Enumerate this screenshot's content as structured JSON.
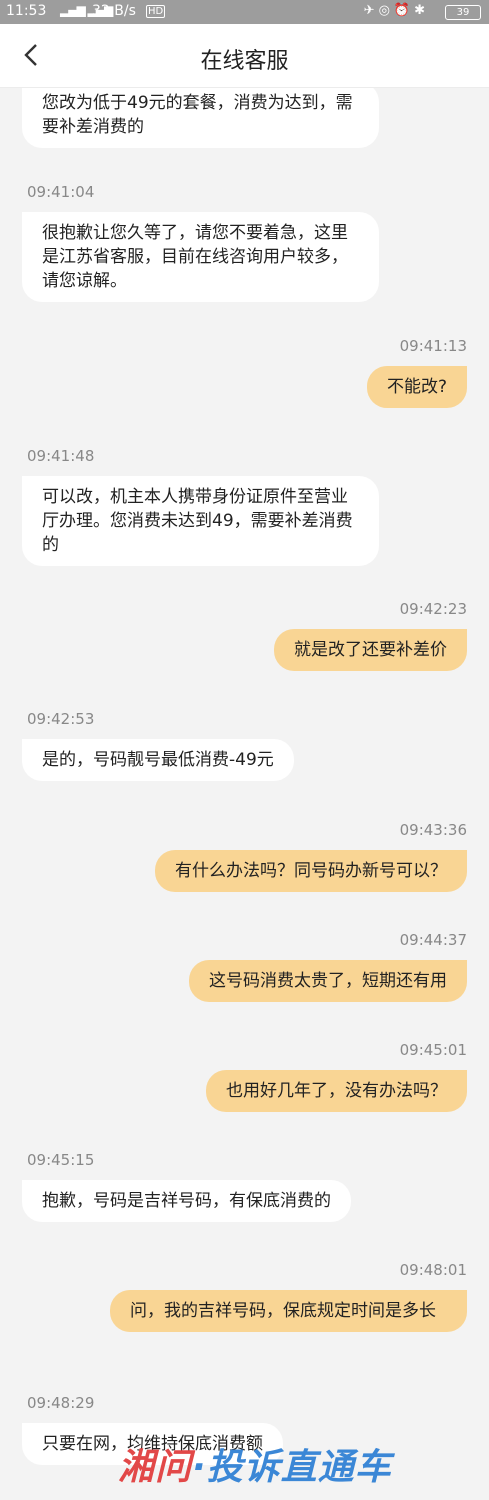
{
  "status_bar": {
    "time": "11:53",
    "net_speed": "32 B/s",
    "hd_label": "HD",
    "battery": "39"
  },
  "header": {
    "title": "在线客服"
  },
  "messages": [
    {
      "side": "in",
      "time": "",
      "text": "您改为低于49元的套餐，消费为达到，需要补差消费的"
    },
    {
      "side": "in",
      "time": "09:41:04",
      "text": "很抱歉让您久等了，请您不要着急，这里是江苏省客服，目前在线咨询用户较多，请您谅解。"
    },
    {
      "side": "out",
      "time": "09:41:13",
      "text": "不能改?"
    },
    {
      "side": "in",
      "time": "09:41:48",
      "text": "可以改，机主本人携带身份证原件至营业厅办理。您消费未达到49，需要补差消费的"
    },
    {
      "side": "out",
      "time": "09:42:23",
      "text": "就是改了还要补差价"
    },
    {
      "side": "in",
      "time": "09:42:53",
      "text": "是的，号码靓号最低消费-49元"
    },
    {
      "side": "out",
      "time": "09:43:36",
      "text": "有什么办法吗？同号码办新号可以？"
    },
    {
      "side": "out",
      "time": "09:44:37",
      "text": "这号码消费太贵了，短期还有用"
    },
    {
      "side": "out",
      "time": "09:45:01",
      "text": "也用好几年了，没有办法吗？"
    },
    {
      "side": "in",
      "time": "09:45:15",
      "text": "抱歉，号码是吉祥号码，有保底消费的"
    },
    {
      "side": "out",
      "time": "09:48:01",
      "text": "问，我的吉祥号码，保底规定时间是多长"
    },
    {
      "side": "in",
      "time": "09:48:29",
      "text": "只要在网，均维持保底消费额"
    }
  ],
  "watermark": {
    "part1": "湘问",
    "part2": "·投诉直通车"
  }
}
